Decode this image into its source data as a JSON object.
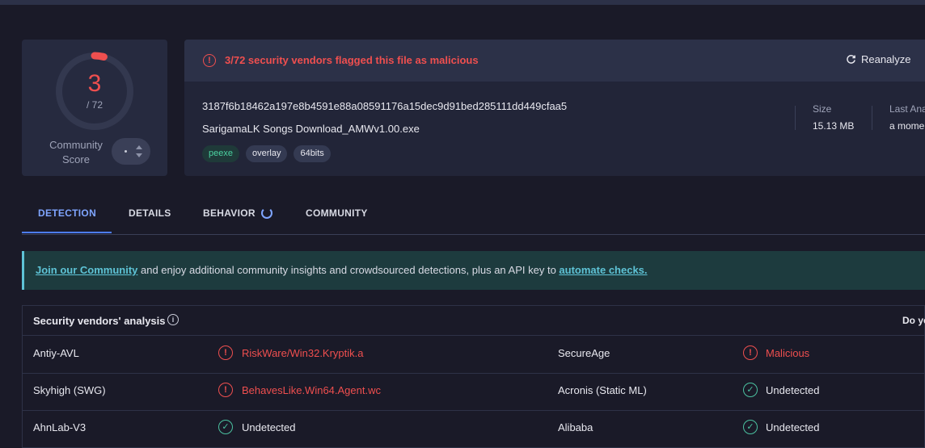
{
  "score": {
    "detections": "3",
    "total": "/ 72",
    "community_label": "Community Score",
    "fraction": 0.0417
  },
  "alert": {
    "text": "3/72 security vendors flagged this file as malicious",
    "reanalyze": "Reanalyze"
  },
  "file": {
    "hash": "3187f6b18462a197e8b4591e88a08591176a15dec9d91bed285111dd449cfaa5",
    "name": "SarigamaLK Songs Download_AMWv1.00.exe",
    "tags": [
      "peexe",
      "overlay",
      "64bits"
    ],
    "size_label": "Size",
    "size_value": "15.13 MB",
    "last_label": "Last Ana",
    "last_value": "a mome"
  },
  "tabs": [
    "DETECTION",
    "DETAILS",
    "BEHAVIOR",
    "COMMUNITY"
  ],
  "banner": {
    "link1": "Join our Community",
    "middle": " and enjoy additional community insights and crowdsourced detections, plus an API key to ",
    "link2": "automate checks."
  },
  "vendors": {
    "title": "Security vendors' analysis",
    "right": "Do yo",
    "rows": [
      {
        "left_name": "Antiy-AVL",
        "left_result": "RiskWare/Win32.Kryptik.a",
        "left_status": "bad",
        "right_name": "SecureAge",
        "right_result": "Malicious",
        "right_status": "bad"
      },
      {
        "left_name": "Skyhigh (SWG)",
        "left_result": "BehavesLike.Win64.Agent.wc",
        "left_status": "bad",
        "right_name": "Acronis (Static ML)",
        "right_result": "Undetected",
        "right_status": "ok"
      },
      {
        "left_name": "AhnLab-V3",
        "left_result": "Undetected",
        "left_status": "ok",
        "right_name": "Alibaba",
        "right_result": "Undetected",
        "right_status": "ok"
      }
    ]
  },
  "colors": {
    "malicious": "#ef4f4f",
    "clean": "#4bc1a0",
    "accent": "#4d7dff",
    "banner_link": "#5ec3d6"
  }
}
